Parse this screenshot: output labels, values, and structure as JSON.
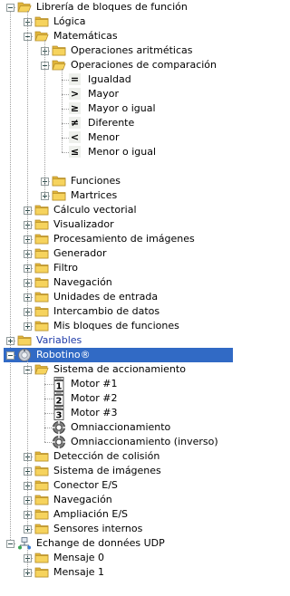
{
  "rows": [
    {
      "id": "libreria",
      "depth": 0,
      "toggle": "minus",
      "icon": "folder-open",
      "label": "Librería de bloques de función"
    },
    {
      "id": "logica",
      "depth": 1,
      "toggle": "plus",
      "icon": "folder",
      "label": "Lógica"
    },
    {
      "id": "matematicas",
      "depth": 1,
      "toggle": "minus",
      "icon": "folder-open",
      "label": "Matemáticas"
    },
    {
      "id": "op-aritmeticas",
      "depth": 2,
      "toggle": "plus",
      "icon": "folder",
      "label": "Operaciones aritméticas"
    },
    {
      "id": "op-comparacion",
      "depth": 2,
      "toggle": "minus",
      "icon": "folder-open",
      "label": "Operaciones de comparación"
    },
    {
      "id": "igualdad",
      "depth": 3,
      "toggle": "none",
      "icon": "block-equal",
      "label": "Igualdad"
    },
    {
      "id": "mayor",
      "depth": 3,
      "toggle": "none",
      "icon": "block-greater",
      "label": "Mayor"
    },
    {
      "id": "mayor-igual",
      "depth": 3,
      "toggle": "none",
      "icon": "block-greater-equal",
      "label": "Mayor o igual"
    },
    {
      "id": "diferente",
      "depth": 3,
      "toggle": "none",
      "icon": "block-not-equal",
      "label": "Diferente"
    },
    {
      "id": "menor",
      "depth": 3,
      "toggle": "none",
      "icon": "block-less",
      "label": "Menor"
    },
    {
      "id": "menor-igual",
      "depth": 3,
      "toggle": "none",
      "icon": "block-less-equal",
      "label": "Menor o igual"
    },
    {
      "id": "spacer",
      "depth": 3,
      "toggle": "none",
      "icon": "none",
      "label": ""
    },
    {
      "id": "funciones",
      "depth": 2,
      "toggle": "plus",
      "icon": "folder",
      "label": "Funciones"
    },
    {
      "id": "martrices",
      "depth": 2,
      "toggle": "plus",
      "icon": "folder",
      "label": "Martrices"
    },
    {
      "id": "calculo-vectorial",
      "depth": 1,
      "toggle": "plus",
      "icon": "folder",
      "label": "Cálculo vectorial"
    },
    {
      "id": "visualizador",
      "depth": 1,
      "toggle": "plus",
      "icon": "folder",
      "label": "Visualizador"
    },
    {
      "id": "procesamiento-imagenes",
      "depth": 1,
      "toggle": "plus",
      "icon": "folder",
      "label": "Procesamiento de imágenes"
    },
    {
      "id": "generador",
      "depth": 1,
      "toggle": "plus",
      "icon": "folder",
      "label": "Generador"
    },
    {
      "id": "filtro",
      "depth": 1,
      "toggle": "plus",
      "icon": "folder",
      "label": "Filtro"
    },
    {
      "id": "navegacion-lib",
      "depth": 1,
      "toggle": "plus",
      "icon": "folder",
      "label": "Navegación"
    },
    {
      "id": "unidades-entrada",
      "depth": 1,
      "toggle": "plus",
      "icon": "folder",
      "label": "Unidades de entrada"
    },
    {
      "id": "intercambio-datos",
      "depth": 1,
      "toggle": "plus",
      "icon": "folder",
      "label": "Intercambio de datos"
    },
    {
      "id": "mis-bloques",
      "depth": 1,
      "toggle": "plus",
      "icon": "folder",
      "label": "Mis bloques de funciones"
    },
    {
      "id": "variables",
      "depth": 0,
      "toggle": "plus",
      "icon": "folder",
      "label": "Variables",
      "style": "blue"
    },
    {
      "id": "robotino",
      "depth": 0,
      "toggle": "minus",
      "icon": "robot",
      "label": "Robotino®",
      "style": "selected"
    },
    {
      "id": "sistema-accionamiento",
      "depth": 1,
      "toggle": "minus",
      "icon": "folder-open",
      "label": "Sistema de accionamiento"
    },
    {
      "id": "motor-1",
      "depth": 2,
      "toggle": "none",
      "icon": "motor-1",
      "label": "Motor #1"
    },
    {
      "id": "motor-2",
      "depth": 2,
      "toggle": "none",
      "icon": "motor-2",
      "label": "Motor #2"
    },
    {
      "id": "motor-3",
      "depth": 2,
      "toggle": "none",
      "icon": "motor-3",
      "label": "Motor #3"
    },
    {
      "id": "omniaccionamiento",
      "depth": 2,
      "toggle": "none",
      "icon": "omni-wheel",
      "label": "Omniaccionamiento"
    },
    {
      "id": "omniaccionamiento-inverso",
      "depth": 2,
      "toggle": "none",
      "icon": "omni-wheel",
      "label": "Omniaccionamiento (inverso)"
    },
    {
      "id": "deteccion-colision",
      "depth": 1,
      "toggle": "plus",
      "icon": "folder",
      "label": "Detección de colisión"
    },
    {
      "id": "sistema-imagenes",
      "depth": 1,
      "toggle": "plus",
      "icon": "folder",
      "label": "Sistema de imágenes"
    },
    {
      "id": "conector-es",
      "depth": 1,
      "toggle": "plus",
      "icon": "folder",
      "label": "Conector E/S"
    },
    {
      "id": "navegacion-robot",
      "depth": 1,
      "toggle": "plus",
      "icon": "folder",
      "label": "Navegación"
    },
    {
      "id": "ampliacion-es",
      "depth": 1,
      "toggle": "plus",
      "icon": "folder",
      "label": "Ampliación E/S"
    },
    {
      "id": "sensores-internos",
      "depth": 1,
      "toggle": "plus",
      "icon": "folder",
      "label": "Sensores internos"
    },
    {
      "id": "udp",
      "depth": 0,
      "toggle": "minus",
      "icon": "network",
      "label": "Echange de données UDP"
    },
    {
      "id": "mensaje-0",
      "depth": 1,
      "toggle": "plus",
      "icon": "folder",
      "label": "Mensaje 0"
    },
    {
      "id": "mensaje-1",
      "depth": 1,
      "toggle": "plus",
      "icon": "folder",
      "label": "Mensaje 1"
    }
  ],
  "colors": {
    "folder_body": "#f6d35d",
    "folder_tab": "#e0b43a",
    "folder_edge": "#b8902b",
    "selection": "#316ac5",
    "variables_text": "#1e3aa8",
    "tree_lines": "#a0a0a0"
  }
}
